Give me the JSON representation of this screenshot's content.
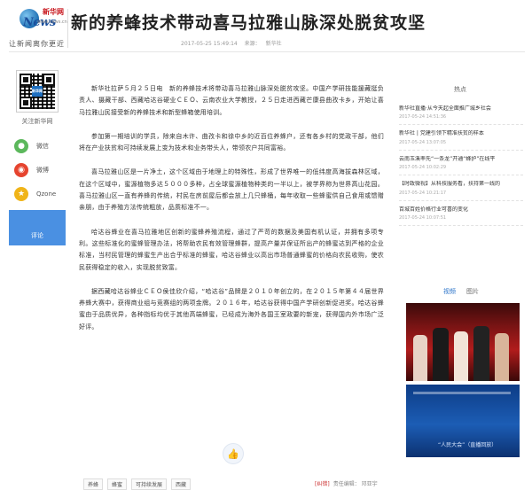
{
  "header": {
    "logo_url_text": "www.news.cn",
    "logo_cn": "新华网",
    "logo_en": "News",
    "slogan": "让新闻离你更近",
    "title": "新的养蜂技术带动喜马拉雅山脉深处脱贫攻坚",
    "timestamp": "2017-05-25 15:49:14",
    "source_label": "来源：",
    "source": "新华社"
  },
  "sidebar": {
    "qr_center_text": "新华网",
    "follow_text": "关注新华网",
    "share": [
      {
        "label": "微信",
        "icon": "wechat-icon",
        "color": "#5cb85c",
        "glyph": "●"
      },
      {
        "label": "微博",
        "icon": "weibo-icon",
        "color": "#e6442f",
        "glyph": "◉"
      },
      {
        "label": "Qzone",
        "icon": "qzone-icon",
        "color": "#f0b418",
        "glyph": "★"
      }
    ],
    "comment_label": "评论"
  },
  "article": {
    "paragraphs": [
      "新华社拉萨５月２５日电　新的养蜂技术将带动喜马拉雅山脉深处脱贫攻坚。中国产学研技能援藏挺负责人、摄藏干部、西藏哈达谷硬业ＣＥＯ、云南农业大学教授，２５日走进西藏芒康县曲孜卡乡，开始让喜马拉雅山民接受新的养蜂技术和新型蜂箱使用培训。",
      "参加第一期培训的学员，除来自木许、曲孜卡和徐中乡的近百位养蜂户，还有各乡村的党政干部，他们将在产业扶贫和可持续发展上变为技术和业务带头人，带领农户共同富裕。",
      "喜马拉雅山区是一片净土，这个区域由于地理上的特殊性，形成了世界唯一的低纬度高海拔森林区域，在这个区域中，蜜源植物多达５０００多种，占全球蜜源植物种类的一半以上，被学界称为世界高山花园。喜马拉雅山区一直有养蜂的传统，村民在房前屋后都会放上几只蜂桶，每年收取一些蜂蜜供自己食用或馈赠亲朋，由于养殖方法传统粗放，品质标准不一。",
      "哈达谷蜂业在喜马拉雅地区创新的蜜蜂养殖流程，通过了严苛的数据及美国有机认证，并拥有多项专利。这些标准化的蜜蜂管理办法，将帮助农民有效管理蜂群，提高产量并保证所出产的蜂蜜达到严格的企业标准，当村民管理的蜂蜜生产出合乎标准的蜂蜜，哈达谷蜂业以高出市场普通蜂蜜的价格向农民收购，使农民获得稳定的收入，实现脱贫致富。",
      "据西藏哈达谷蜂业ＣＥＯ侯佳欣介绍，“哈达谷”品牌是２０１０年创立的，在２０１５年第４４届世界养蜂大赛中，获得商业组与竞赛组的两项金牌。２０１６年，哈达谷获得中国产学研创新促进奖。哈达谷蜂蜜由于品质优异，各种指标均优于其他高端蜂蜜，已经成为海外各国王室政要的新宠，获得国内外市场广泛好评。"
    ],
    "tags": [
      "养蜂",
      "蜂蜜",
      "可持续发展",
      "西藏"
    ],
    "error_report": "[纠错]",
    "editor": "责任编辑： 邓亚宇"
  },
  "right": {
    "hot_title": "热点",
    "hot_items": [
      {
        "text": "新华社直播·从今天起全面推广城乡社会",
        "time": "2017-05-24 14:51:36"
      },
      {
        "text": "新华社 | 党建引领下精准扶贫的样本",
        "time": "2017-05-24 13:07:05"
      },
      {
        "text": "云南玉溪率先“一条龙”开通“蜂护”在线平",
        "time": "2017-05-24 10:02:29"
      },
      {
        "text": "【时政微视】从科技服务看，扶持第一线的",
        "time": "2017-05-24 10:21:17"
      },
      {
        "text": "百城百姓价格行业可喜的变化",
        "time": "2017-05-24 10:07:51"
      }
    ],
    "video_tabs": [
      "视频",
      "图片"
    ],
    "thumb2_caption": "“人民大会”（直播回放）"
  }
}
